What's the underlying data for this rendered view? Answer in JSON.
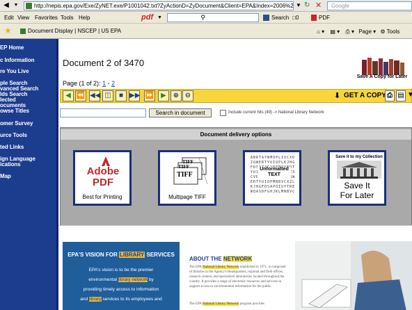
{
  "browser": {
    "url": "http://nepis.epa.gov/Exe/ZyNET.exe/P1001042.txt?ZyActionD=ZyDocument&Client=EPA&Index=2006%20Thru%202010%",
    "google_placeholder": "Google",
    "menu": [
      "Edit",
      "View",
      "Favorites",
      "Tools",
      "Help"
    ],
    "pdf_toolbar_label": "pdf",
    "search_label": "Search",
    "count_label": "0",
    "pdf_button_label": "PDF",
    "tab_title": "Document Display | NSCEP | US EPA",
    "tools_label": "Page",
    "tools_label2": "Tools"
  },
  "left_nav": {
    "items": [
      "EP Home",
      "c Information",
      "re You Live",
      "ple Search",
      "vanced Search",
      "lds Search",
      "lected",
      "ocuments",
      "owse Titles",
      "omer Survey",
      "urce Tools",
      "ted Links",
      "ign Language",
      "ications",
      "Map"
    ]
  },
  "document": {
    "title": "Document 2 of 3470",
    "page_prefix": "Page (1 of 2):",
    "page_1": "1",
    "page_sep": "-",
    "page_2": "2",
    "save_caption": "Save A Copy for Later"
  },
  "toolbar": {
    "get_copy_label": "GET A COPY"
  },
  "search": {
    "button_label": "Search in document",
    "include_label": "Include current hits (49) -> National Library Network"
  },
  "delivery": {
    "header": "Document delivery options",
    "pdf_logo_text": "Adobe PDF",
    "pdf_caption": "Best for Printing",
    "tiff_caption": "Multipage TIFF",
    "tiff_label_1": "TIFF",
    "tiff_label_2": "TIFF",
    "tiff_label_3": "TIFF",
    "unformatted_line1": "Unformatted",
    "unformatted_line2": "TEXT",
    "save_top": "Save it to my Collection",
    "save_line1": "Save It",
    "save_line2": "For Later"
  },
  "vision": {
    "title_prefix": "EPA'S VISION FOR",
    "title_hl": "LIBRARY",
    "title_suffix": "SERVICES",
    "line1": "EPA's vision is to be the premier",
    "line2_a": "environmental",
    "line2_hl": "library network",
    "line2_b": "by",
    "line3": "providing timely access to information",
    "line4_a": "and",
    "line4_hl": "library",
    "line4_b": "services to its employees and",
    "about_prefix": "ABOUT THE",
    "about_hl": "NETWORK",
    "about_1a": "The EPA",
    "about_1hl": "National Library Network",
    "about_1b": "established in 1971, is composed of libraries in the Agency's Headquarters, regional and field offices, research centers, and specialized laboratories located throughout the country. It provides a range of electronic resources and services to support access to environmental information for the public.",
    "about_2a": "The EPA",
    "about_2hl": "National Library Network",
    "about_2b": "program provides"
  }
}
